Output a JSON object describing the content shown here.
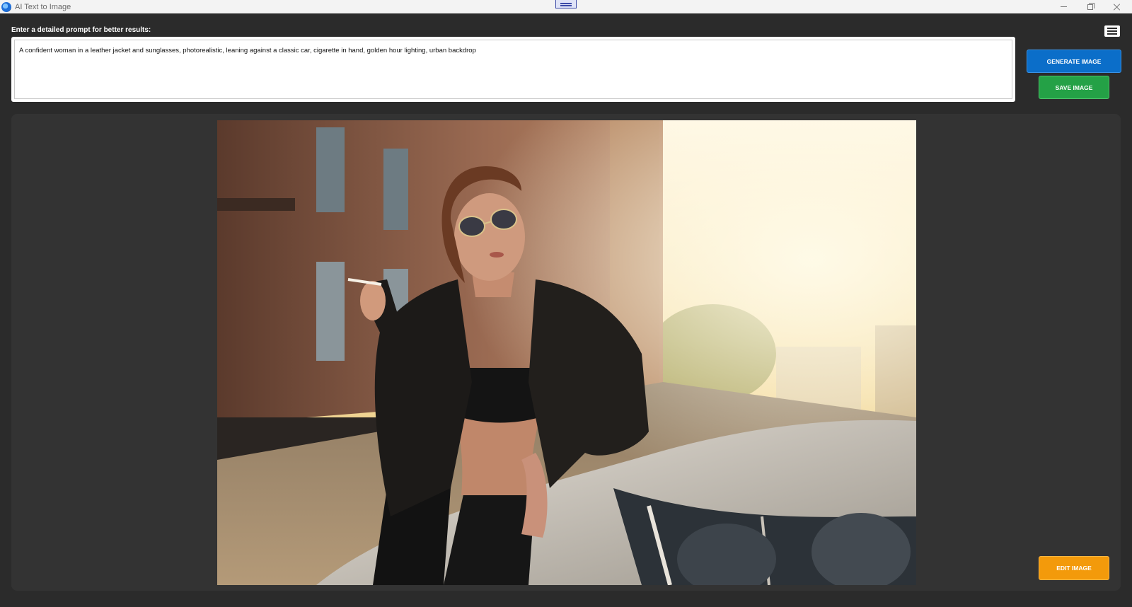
{
  "window": {
    "title": "AI Text to Image"
  },
  "prompt": {
    "label": "Enter a detailed prompt for better results:",
    "value": "A confident woman in a leather jacket and sunglasses, photorealistic, leaning against a classic car, cigarette in hand, golden hour lighting, urban backdrop"
  },
  "buttons": {
    "generate": "GENERATE IMAGE",
    "save": "SAVE IMAGE",
    "edit": "EDIT IMAGE"
  },
  "icons": {
    "app": "app-logo-icon",
    "menu": "hamburger-menu-icon",
    "minimize": "minimize-icon",
    "maximize": "restore-icon",
    "close": "close-icon"
  },
  "colors": {
    "background": "#2b2b2b",
    "panel": "#333333",
    "generate": "#0b6ec9",
    "save": "#24a146",
    "edit": "#f39a0b"
  }
}
